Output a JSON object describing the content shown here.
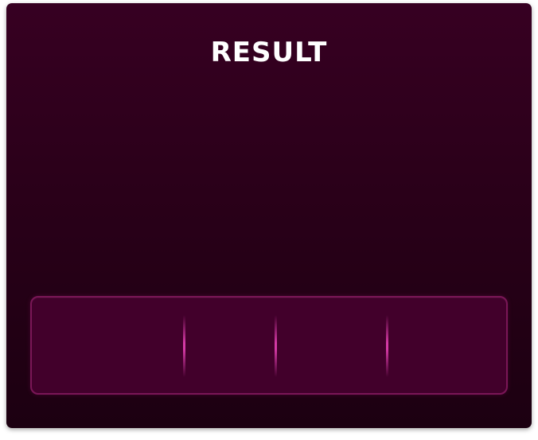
{
  "result": {
    "title": "RESULT"
  }
}
